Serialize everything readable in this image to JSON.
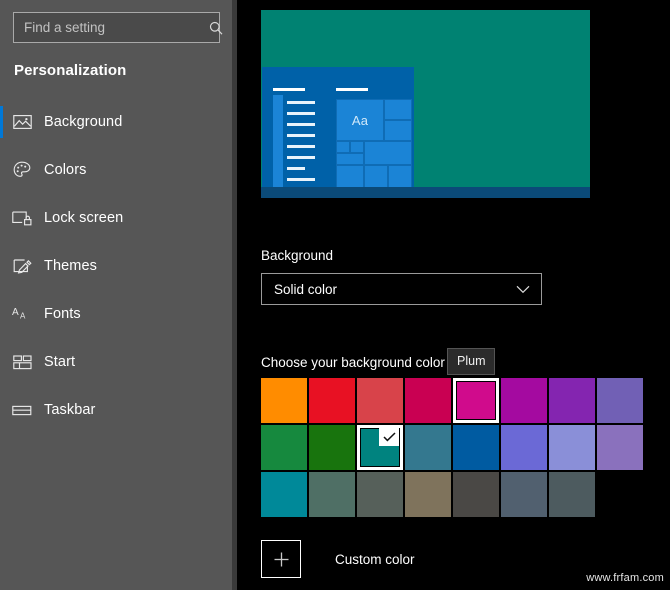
{
  "sidebar": {
    "search": {
      "placeholder": "Find a setting",
      "value": "",
      "icon": "search-icon"
    },
    "section_title": "Personalization",
    "items": [
      {
        "label": "Background",
        "icon": "picture-icon",
        "selected": true
      },
      {
        "label": "Colors",
        "icon": "palette-icon",
        "selected": false
      },
      {
        "label": "Lock screen",
        "icon": "lockscreen-icon",
        "selected": false
      },
      {
        "label": "Themes",
        "icon": "brush-icon",
        "selected": false
      },
      {
        "label": "Fonts",
        "icon": "fonts-icon",
        "selected": false
      },
      {
        "label": "Start",
        "icon": "start-icon",
        "selected": false
      },
      {
        "label": "Taskbar",
        "icon": "taskbar-icon",
        "selected": false
      }
    ],
    "accent_color": "#0078d7",
    "background_color": "#565656"
  },
  "preview": {
    "desktop_color": "#008272",
    "startmenu_color": "#0061a8",
    "tile_color": "#1b84d6",
    "taskbar_color": "#0b4a78",
    "tile_text": "Aa"
  },
  "main": {
    "background_label": "Background",
    "background_dropdown": {
      "value": "Solid color",
      "chevron": "chevron-down-icon"
    },
    "choose_color_label": "Choose your background color",
    "tooltip": {
      "text": "Plum",
      "visible": true
    },
    "custom_color": {
      "label": "Custom color",
      "icon": "plus-icon"
    }
  },
  "swatches": {
    "rows": [
      [
        {
          "color": "#ff8c00",
          "state": "normal"
        },
        {
          "color": "#e81123",
          "state": "normal"
        },
        {
          "color": "#d8434a",
          "state": "normal"
        },
        {
          "color": "#c90052",
          "state": "normal"
        },
        {
          "color": "#d00b8c",
          "state": "highlighted"
        },
        {
          "color": "#a40aa0",
          "state": "normal"
        },
        {
          "color": "#8425b0",
          "state": "normal"
        },
        {
          "color": "#7160b5",
          "state": "normal"
        }
      ],
      [
        {
          "color": "#16893e",
          "state": "normal"
        },
        {
          "color": "#18740d",
          "state": "normal"
        },
        {
          "color": "#00837f",
          "state": "selected"
        },
        {
          "color": "#34788f",
          "state": "normal"
        },
        {
          "color": "#005ba1",
          "state": "normal"
        },
        {
          "color": "#6b69d6",
          "state": "normal"
        },
        {
          "color": "#8a8fd8",
          "state": "normal"
        },
        {
          "color": "#8a71bd",
          "state": "normal"
        }
      ],
      [
        {
          "color": "#008999",
          "state": "normal"
        },
        {
          "color": "#4f6f65",
          "state": "normal"
        },
        {
          "color": "#56605a",
          "state": "normal"
        },
        {
          "color": "#7f735c",
          "state": "normal"
        },
        {
          "color": "#4a4845",
          "state": "normal"
        },
        {
          "color": "#51606f",
          "state": "normal"
        },
        {
          "color": "#4d5b5f",
          "state": "normal"
        },
        {
          "color": "",
          "state": "empty"
        }
      ]
    ],
    "selected_check": "check-icon"
  },
  "watermark": "www.frfam.com"
}
